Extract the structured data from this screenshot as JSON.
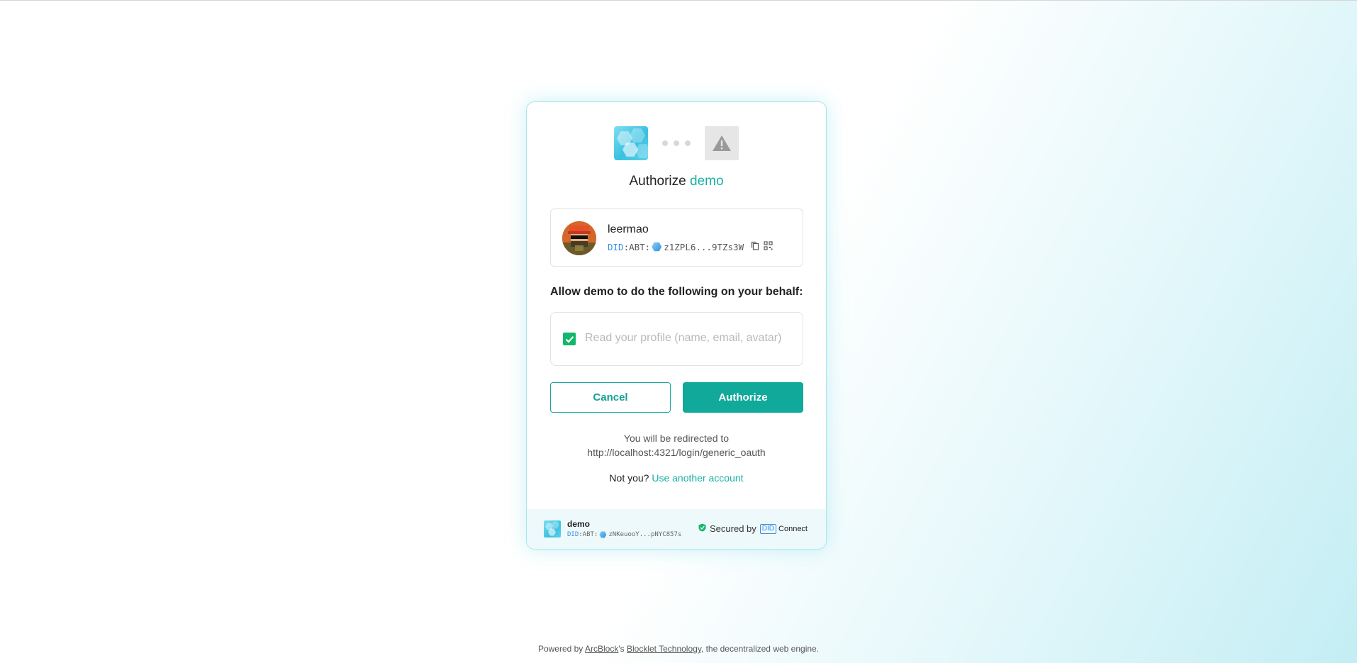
{
  "auth": {
    "title_prefix": "Authorize",
    "app_name": "demo"
  },
  "user": {
    "name": "leermao",
    "did_prefix": "DID",
    "did_chain": ":ABT:",
    "did_short": "z1ZPL6...9TZs3W"
  },
  "permissions": {
    "heading": "Allow demo to do the following on your behalf:",
    "items": [
      {
        "label": "Read your profile (name, email, avatar)",
        "checked": true
      }
    ]
  },
  "buttons": {
    "cancel": "Cancel",
    "authorize": "Authorize"
  },
  "redirect": {
    "line1": "You will be redirected to",
    "url": "http://localhost:4321/login/generic_oauth"
  },
  "switch_account": {
    "prompt": "Not you?",
    "link": "Use another account"
  },
  "footer": {
    "app_name": "demo",
    "did_prefix": "DID",
    "did_chain": ":ABT:",
    "did_short": "zNKeuooY...pNYC857s",
    "secured_by": "Secured by",
    "did_badge": "DID",
    "connect": "Connect"
  },
  "powered": {
    "prefix": "Powered by",
    "arcblock": "ArcBlock",
    "possessive": "'s",
    "blocklet": "Blocklet Technology",
    "suffix": ", the decentralized web engine."
  },
  "colors": {
    "accent": "#19b0a3",
    "primary_button": "#10a99a",
    "checkbox": "#11b86a",
    "did_blue": "#3a8fdc"
  }
}
